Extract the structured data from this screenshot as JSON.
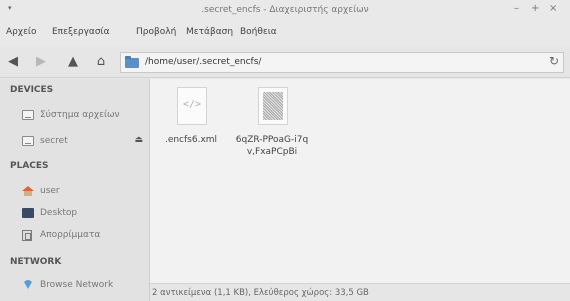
{
  "window": {
    "title": ".secret_encfs - Διαχειριστής αρχείων",
    "controls": {
      "minimize": "–",
      "maximize": "+",
      "close": "×"
    }
  },
  "menubar": {
    "items": [
      "Αρχείο",
      "Επεξεργασία",
      "Προβολή",
      "Μετάβαση",
      "Βοήθεια"
    ]
  },
  "toolbar": {
    "back_icon": "arrow-left-icon",
    "forward_icon": "arrow-right-icon",
    "up_icon": "arrow-up-icon",
    "home_icon": "home-icon",
    "path": "/home/user/.secret_encfs/",
    "reload_icon": "reload-icon"
  },
  "sidebar": {
    "sections": [
      {
        "heading": "DEVICES",
        "items": [
          {
            "label": "Σύστημα αρχείων",
            "icon": "drive-icon"
          },
          {
            "label": "secret",
            "icon": "drive-icon",
            "eject": "⏏"
          }
        ]
      },
      {
        "heading": "PLACES",
        "items": [
          {
            "label": "user",
            "icon": "home-icon"
          },
          {
            "label": "Desktop",
            "icon": "desktop-icon"
          },
          {
            "label": "Απορρίμματα",
            "icon": "trash-icon"
          }
        ]
      },
      {
        "heading": "NETWORK",
        "items": [
          {
            "label": "Browse Network",
            "icon": "network-icon"
          }
        ]
      }
    ]
  },
  "files": [
    {
      "name": ".encfs6.xml",
      "icon": "xml-file-icon",
      "glyph": "</>"
    },
    {
      "name": "6qZR-PPoaG-i7qv,FxaPCpBi",
      "icon": "binary-file-icon"
    }
  ],
  "statusbar": {
    "text": "2 αντικείμενα (1,1 KB), Ελεύθερος χώρος: 33,5 GB"
  },
  "colors": {
    "accent": "#5b8fc7",
    "sidebar_bg": "#e2e2e2",
    "content_bg": "#f2f2f2"
  }
}
